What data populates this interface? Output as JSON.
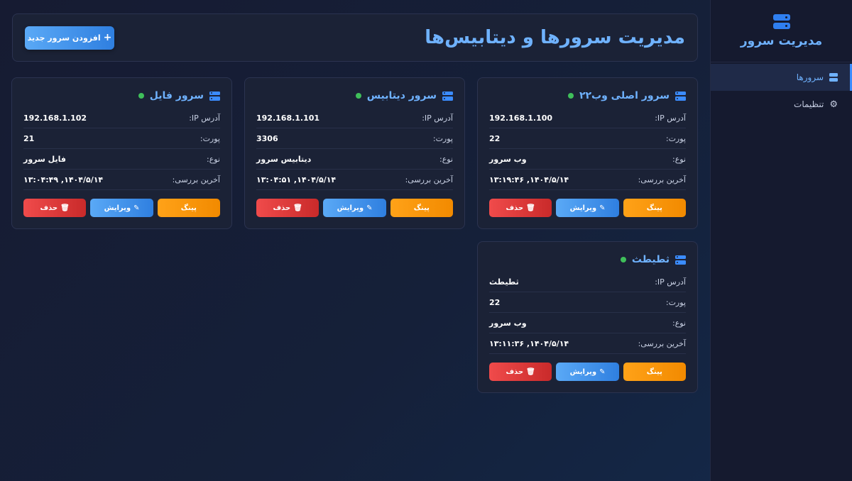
{
  "sidebar": {
    "brand_title": "مدیریت سرور",
    "items": [
      {
        "label": "سرورها",
        "icon": "server-icon",
        "active": true
      },
      {
        "label": "تنظیمات",
        "icon": "gear-icon",
        "active": false
      }
    ]
  },
  "header": {
    "title": "مدیریت سرورها و دیتابیس‌ها",
    "add_button": "افزودن سرور جدید"
  },
  "labels": {
    "ip": "آدرس IP:",
    "port": "پورت:",
    "type": "نوع:",
    "last_check": "آخرین بررسی:",
    "ping": "پینگ",
    "edit": "ویرایش",
    "delete": "حذف"
  },
  "servers": [
    {
      "name": "سرور اصلی وب۲۲",
      "ip": "192.168.1.100",
      "port": "22",
      "type": "وب سرور",
      "last_check": "۱۴۰۴/۵/۱۴, ۱۳:۱۹:۴۶",
      "status": "online"
    },
    {
      "name": "سرور دیتابیس",
      "ip": "192.168.1.101",
      "port": "3306",
      "type": "دیتابیس سرور",
      "last_check": "۱۴۰۴/۵/۱۴, ۱۳:۰۴:۵۱",
      "status": "online"
    },
    {
      "name": "سرور فایل",
      "ip": "192.168.1.102",
      "port": "21",
      "type": "فایل سرور",
      "last_check": "۱۴۰۴/۵/۱۴, ۱۳:۰۴:۴۹",
      "status": "online"
    },
    {
      "name": "ثطیطث",
      "ip": "ثطیطث",
      "port": "22",
      "type": "وب سرور",
      "last_check": "۱۴۰۴/۵/۱۴, ۱۳:۱۱:۳۶",
      "status": "online"
    }
  ],
  "colors": {
    "accent": "#3b8cff",
    "online": "#3fbf5a",
    "ping": "#f7950f",
    "edit": "#3d8fe8",
    "delete": "#e03a3a"
  }
}
